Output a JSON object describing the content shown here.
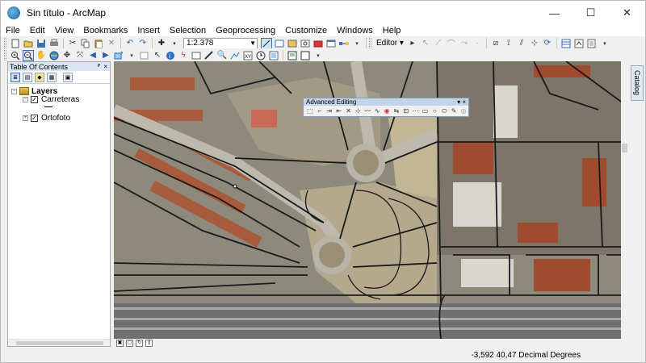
{
  "window": {
    "title": "Sin título - ArcMap",
    "controls": {
      "minimize": "—",
      "maximize": "☐",
      "close": "✕"
    }
  },
  "menu": [
    "File",
    "Edit",
    "View",
    "Bookmarks",
    "Insert",
    "Selection",
    "Geoprocessing",
    "Customize",
    "Windows",
    "Help"
  ],
  "toolbar": {
    "scale": "1:2.378",
    "editor_label": "Editor ▾"
  },
  "toc": {
    "title": "Table Of Contents",
    "header_buttons": {
      "pin": "ᴾ",
      "close": "×"
    },
    "layers_group": "Layers",
    "layers": [
      {
        "name": "Carreteras",
        "checked": true
      },
      {
        "name": "Ortofoto",
        "checked": true
      }
    ],
    "expander_open": "−",
    "expander_closed": "+",
    "check_mark": "✓"
  },
  "advanced_editing": {
    "title": "Advanced Editing",
    "buttons": "▾ ×"
  },
  "catalog_tab": "Catalog",
  "status": {
    "coordinates": "-3,592  40,47 Decimal Degrees"
  },
  "colors": {
    "accent": "#dbe6f4",
    "toc_bg": "#ffffff",
    "map_base": "#8d8a7c",
    "road": "#1a1a1a",
    "roof": "#a85a3c"
  }
}
